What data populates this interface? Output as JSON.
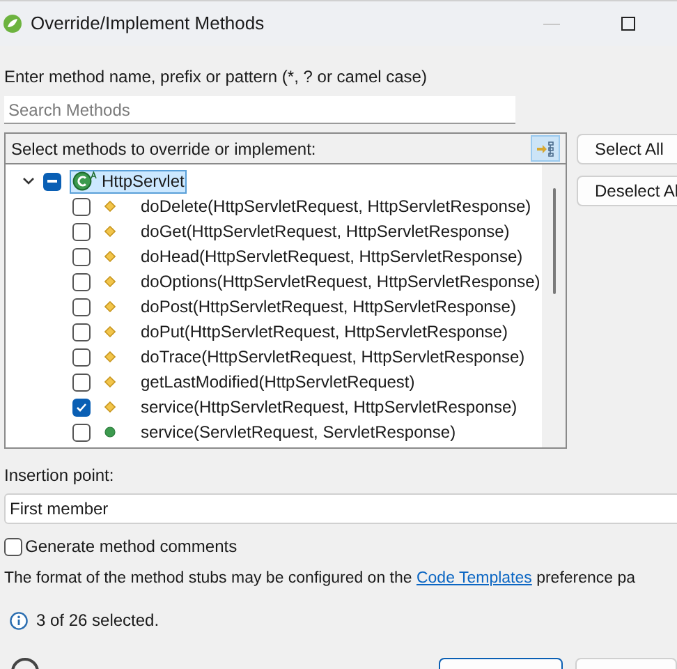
{
  "window": {
    "title": "Override/Implement Methods"
  },
  "filter": {
    "label": "Enter method name, prefix or pattern (*, ? or camel case)",
    "placeholder": "Search Methods"
  },
  "tree": {
    "header": "Select methods to override or implement:",
    "root": {
      "label": "HttpServlet",
      "expanded": true,
      "selected": true,
      "partial": true,
      "children": [
        {
          "label": "doDelete(HttpServletRequest, HttpServletResponse)",
          "kind": "protected",
          "checked": false
        },
        {
          "label": "doGet(HttpServletRequest, HttpServletResponse)",
          "kind": "protected",
          "checked": false
        },
        {
          "label": "doHead(HttpServletRequest, HttpServletResponse)",
          "kind": "protected",
          "checked": false
        },
        {
          "label": "doOptions(HttpServletRequest, HttpServletResponse)",
          "kind": "protected",
          "checked": false
        },
        {
          "label": "doPost(HttpServletRequest, HttpServletResponse)",
          "kind": "protected",
          "checked": false
        },
        {
          "label": "doPut(HttpServletRequest, HttpServletResponse)",
          "kind": "protected",
          "checked": false
        },
        {
          "label": "doTrace(HttpServletRequest, HttpServletResponse)",
          "kind": "protected",
          "checked": false
        },
        {
          "label": "getLastModified(HttpServletRequest)",
          "kind": "protected",
          "checked": false
        },
        {
          "label": "service(HttpServletRequest, HttpServletResponse)",
          "kind": "protected",
          "checked": true
        },
        {
          "label": "service(ServletRequest, ServletResponse)",
          "kind": "public",
          "checked": false
        }
      ]
    }
  },
  "side_buttons": [
    "Select All",
    "Deselect Al"
  ],
  "insertion": {
    "label": "Insertion point:",
    "value": "First member"
  },
  "comments": {
    "label": "Generate method comments",
    "checked": false
  },
  "note": {
    "before": "The format of the method stubs may be configured on the ",
    "link": "Code Templates",
    "after": " preference pa"
  },
  "status": "3 of 26 selected."
}
